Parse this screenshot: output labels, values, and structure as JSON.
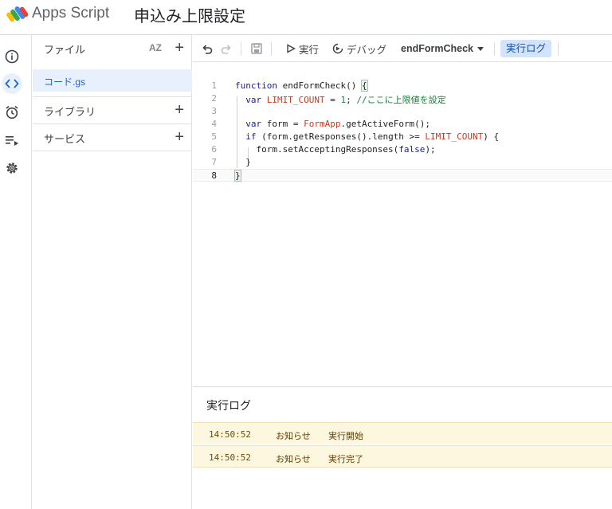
{
  "header": {
    "app_name": "Apps Script",
    "project_title": "申込み上限設定"
  },
  "rail": {
    "items": [
      {
        "name": "overview",
        "icon": "info-icon"
      },
      {
        "name": "editor",
        "icon": "code-icon",
        "active": true
      },
      {
        "name": "triggers",
        "icon": "alarm-clock-icon"
      },
      {
        "name": "executions",
        "icon": "executions-list-icon"
      },
      {
        "name": "settings",
        "icon": "gear-icon"
      }
    ]
  },
  "files": {
    "section_label": "ファイル",
    "sort_label": "AZ",
    "items": [
      {
        "label": "コード.gs"
      }
    ],
    "libraries_label": "ライブラリ",
    "services_label": "サービス"
  },
  "toolbar": {
    "run_label": "実行",
    "debug_label": "デバッグ",
    "function_name": "endFormCheck",
    "log_label": "実行ログ"
  },
  "editor": {
    "line_numbers": [
      "1",
      "2",
      "3",
      "4",
      "5",
      "6",
      "7",
      "8"
    ],
    "current_line": 8
  },
  "log": {
    "title": "実行ログ",
    "entries": [
      {
        "time": "14:50:52",
        "severity": "お知らせ",
        "message": "実行開始"
      },
      {
        "time": "14:50:52",
        "severity": "お知らせ",
        "message": "実行完了"
      }
    ]
  },
  "colors": {
    "accent": "#1a73e8",
    "active_bg": "#e8f0fe",
    "log_bg": "#fef7e0"
  }
}
